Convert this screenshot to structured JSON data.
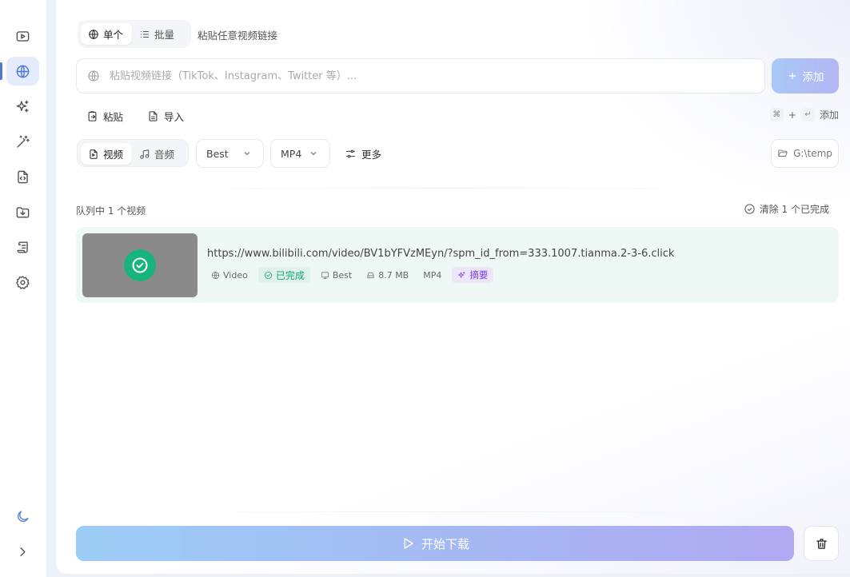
{
  "sidebar": {
    "items": [
      {
        "name": "video-icon",
        "active": false
      },
      {
        "name": "globe-icon",
        "active": true
      },
      {
        "name": "sparkles-icon",
        "active": false
      },
      {
        "name": "magic-wand-icon",
        "active": false
      },
      {
        "name": "code-file-icon",
        "active": false
      },
      {
        "name": "download-folder-icon",
        "active": false
      },
      {
        "name": "scroll-icon",
        "active": false
      },
      {
        "name": "gear-icon",
        "active": false
      }
    ],
    "bottom": [
      "moon-icon",
      "chevron-right-icon"
    ],
    "accent_color": "#4d79d4"
  },
  "mode": {
    "single_label": "单个",
    "batch_label": "批量",
    "hint": "粘贴任意视频链接"
  },
  "url_input": {
    "placeholder": "粘贴视频链接（TikTok、Instagram、Twitter 等）...",
    "value": ""
  },
  "add_button": {
    "label": "添加"
  },
  "tools": {
    "paste_label": "粘贴",
    "import_label": "导入",
    "shortcut_cmd": "⌘",
    "shortcut_plus": "+",
    "shortcut_enter": "↵",
    "shortcut_action": "添加"
  },
  "format": {
    "video_label": "视频",
    "audio_label": "音频",
    "quality": "Best",
    "container": "MP4",
    "more_label": "更多",
    "output_folder": "G:\\temp"
  },
  "queue": {
    "count_label": "队列中 1 个视频",
    "clear_label": "清除 1 个已完成",
    "items": [
      {
        "url": "https://www.bilibili.com/video/BV1bYFVzMEyn/?spm_id_from=333.1007.tianma.2-3-6.click",
        "type": "Video",
        "status": "已完成",
        "quality": "Best",
        "size": "8.7 MB",
        "format": "MP4",
        "summary_label": "摘要",
        "status_color": "#17b47e"
      }
    ]
  },
  "actions": {
    "start_label": "开始下载"
  }
}
